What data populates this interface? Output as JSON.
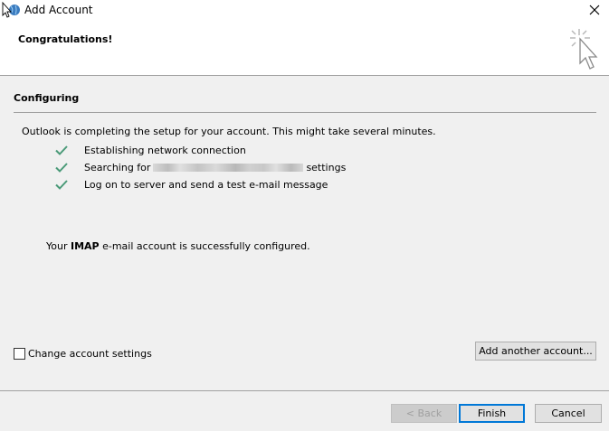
{
  "window": {
    "title": "Add Account"
  },
  "header": {
    "title": "Congratulations!"
  },
  "section": {
    "title": "Configuring"
  },
  "intro": "Outlook is completing the setup for your account. This might take several minutes.",
  "steps": [
    {
      "label": "Establishing network connection",
      "status": "done"
    },
    {
      "label_prefix": "Searching for",
      "label_suffix": "settings",
      "status": "done",
      "redacted": true
    },
    {
      "label": "Log on to server and send a test e-mail message",
      "status": "done"
    }
  ],
  "success": {
    "prefix": "Your",
    "protocol": "IMAP",
    "suffix": "e-mail account is successfully configured."
  },
  "options": {
    "change_settings_label": "Change account settings",
    "change_settings_checked": false
  },
  "buttons": {
    "add_another": "Add another account...",
    "back": "< Back",
    "finish": "Finish",
    "cancel": "Cancel"
  },
  "colors": {
    "check": "#4a9a78",
    "focus_border": "#0078d7",
    "disabled_text": "#a0a0a0"
  },
  "icons": {
    "app": "outlook-globe-icon",
    "close": "close-icon",
    "header": "click-cursor-icon",
    "check": "checkmark-icon"
  }
}
